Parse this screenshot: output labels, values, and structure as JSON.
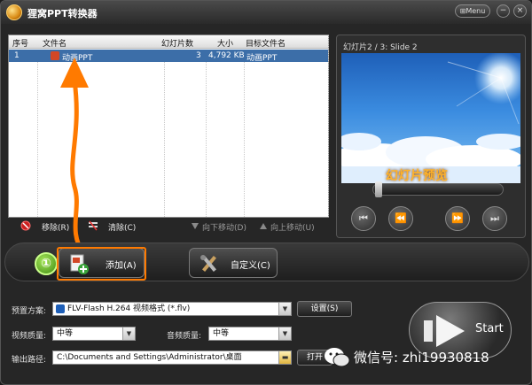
{
  "window": {
    "title": "狸窝PPT转换器",
    "menu_label": "Menu",
    "minimize_glyph": "−",
    "close_glyph": "×"
  },
  "file_list": {
    "columns": [
      "序号",
      "文件名",
      "幻灯片数",
      "大小",
      "目标文件名"
    ],
    "rows": [
      {
        "index": "1",
        "filename": "动画PPT",
        "slides": "3",
        "size": "4,792 KB",
        "target": "动画PPT"
      }
    ]
  },
  "list_actions": {
    "remove": "移除(R)",
    "clear": "清除(C)",
    "move_down": "向下移动(D)",
    "move_up": "向上移动(U)"
  },
  "preview": {
    "label": "幻灯片2 / 3: Slide 2",
    "caption": "幻灯片预览",
    "controls": {
      "prev": "⏮",
      "rewind": "⏪",
      "forward": "⏩",
      "next": "⏭"
    }
  },
  "main_buttons": {
    "step_badge": "①",
    "add": "添加(A)",
    "customize": "自定义(C)"
  },
  "settings": {
    "preset_label": "预置方案:",
    "preset_value": "FLV-Flash H.264 视频格式 (*.flv)",
    "preset_button": "设置(S)",
    "video_quality_label": "视频质量:",
    "video_quality_value": "中等",
    "audio_quality_label": "音频质量:",
    "audio_quality_value": "中等",
    "output_label": "输出路径:",
    "output_value": "C:\\Documents and Settings\\Administrator\\桌面",
    "open_button": "打开"
  },
  "start_button": {
    "label": "Start"
  },
  "watermark": {
    "text": "微信号: zhi19930818"
  },
  "colors": {
    "accent_orange": "#ff7a00",
    "selection_blue": "#3c6ea8",
    "caption_orange": "#ffb22a"
  }
}
